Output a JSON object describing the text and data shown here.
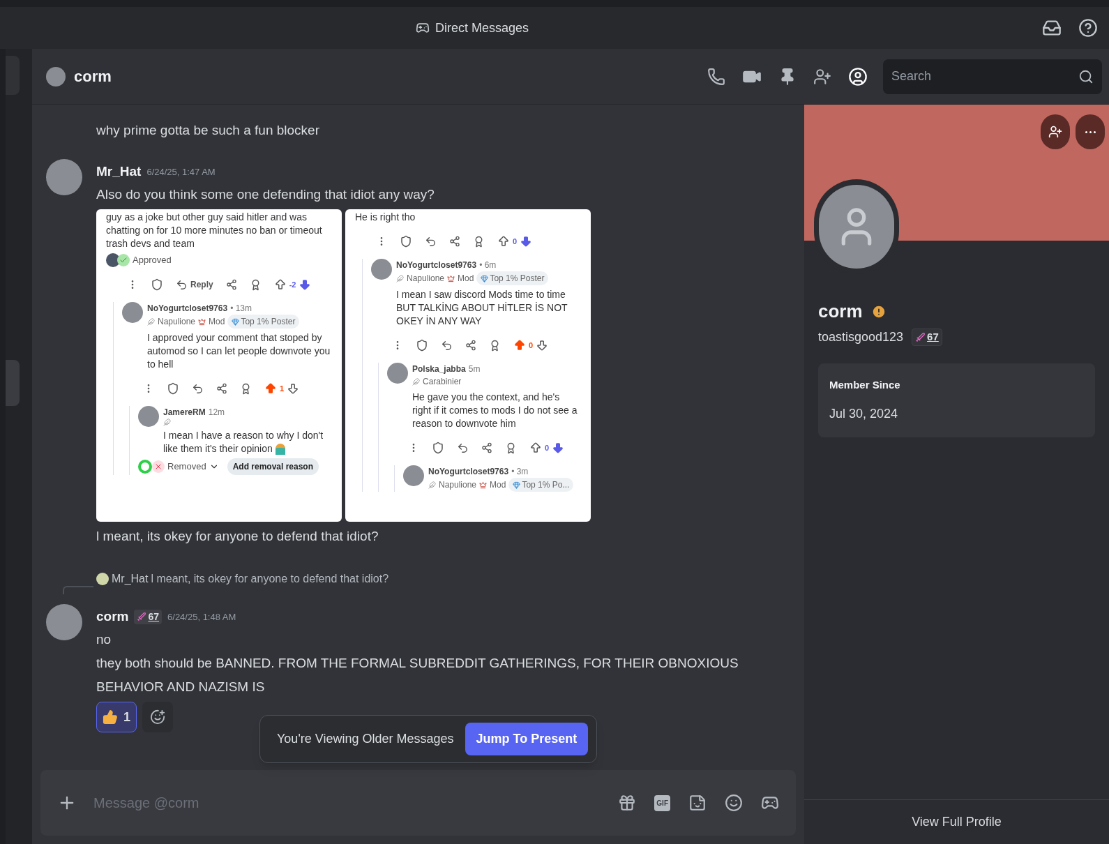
{
  "title_bar": {
    "title": "Direct Messages"
  },
  "header": {
    "name": "corm",
    "search": {
      "placeholder": "Search"
    }
  },
  "messages": [
    {
      "kind": "text",
      "text": "why prime gotta be such a fun blocker"
    },
    {
      "kind": "header",
      "author": "Mr_Hat",
      "time": "6/24/25, 1:47 AM"
    },
    {
      "kind": "text",
      "text": "Also do you think some one defending that idiot any way?"
    },
    {
      "kind": "screenshots",
      "images": [
        {
          "items": [
            {
              "kind": "text",
              "text": "guy as a joke but other guy said hitler and was chatting on for 10 more minutes no ban or timeout trash devs and team"
            },
            {
              "kind": "status",
              "approved": true,
              "label": "Approved"
            },
            {
              "kind": "actions",
              "reply": "Reply",
              "score": "-2",
              "upvoted": false,
              "downvoted": true
            },
            {
              "kind": "thread",
              "children": [
                {
                  "kind": "comment",
                  "user": "NoYogurtcloset9763",
                  "age": "• 13m",
                  "flair": "Napulione",
                  "role": "Mod",
                  "badge": "Top 1% Poster",
                  "text": "I approved your comment that stoped by automod so I can let people downvote you to hell"
                },
                {
                  "kind": "actions",
                  "score": "1",
                  "upvoted": true,
                  "downvoted": false
                },
                {
                  "kind": "thread",
                  "children": [
                    {
                      "kind": "comment",
                      "user": "JamereRM",
                      "age": "12m",
                      "text": "I mean I have a reason to why I don't like them it's their opinion",
                      "emoji": true
                    },
                    {
                      "kind": "status",
                      "approved": false,
                      "label": "Removed",
                      "button": "Add removal reason"
                    }
                  ]
                }
              ]
            }
          ]
        },
        {
          "items": [
            {
              "kind": "text",
              "text": "He is right tho"
            },
            {
              "kind": "actions",
              "score": "0",
              "upvoted": false,
              "downvoted": true
            },
            {
              "kind": "thread",
              "children": [
                {
                  "kind": "comment",
                  "user": "NoYogurtcloset9763",
                  "age": "• 6m",
                  "flair": "Napulione",
                  "role": "Mod",
                  "badge": "Top 1% Poster",
                  "text": "I mean I saw discord Mods time to time BUT TALKİNG ABOUT HİTLER İS NOT OKEY İN ANY WAY"
                },
                {
                  "kind": "actions",
                  "score": "0",
                  "upvoted": true,
                  "downvoted": false
                },
                {
                  "kind": "thread",
                  "children": [
                    {
                      "kind": "comment",
                      "user": "Polska_jabba",
                      "age": "5m",
                      "flair": "Carabinier",
                      "text": "He gave you the context, and he's right if it comes to mods I do not see a reason to downvote him"
                    },
                    {
                      "kind": "actions",
                      "score": "0",
                      "upvoted": false,
                      "downvoted": true
                    },
                    {
                      "kind": "thread",
                      "children": [
                        {
                          "kind": "comment",
                          "user": "NoYogurtcloset9763",
                          "age": "• 3m",
                          "flair": "Napulione",
                          "role": "Mod",
                          "badge": "Top 1% Po..."
                        }
                      ]
                    }
                  ]
                }
              ]
            }
          ]
        }
      ]
    },
    {
      "kind": "text",
      "text": "l meant, its okey for anyone to defend that idiot?"
    },
    {
      "kind": "reply",
      "author": "Mr_Hat",
      "text": "l meant, its okey for anyone to defend that idiot?"
    },
    {
      "kind": "header",
      "author": "corm",
      "badge": "67",
      "time": "6/24/25, 1:48 AM"
    },
    {
      "kind": "text",
      "text": "no"
    },
    {
      "kind": "text",
      "text": "they both should be BANNED. FROM THE FORMAL SUBREDDIT GATHERINGS, FOR THEIR OBNOXIOUS BEHAVIOR AND NAZISM IS"
    },
    {
      "kind": "reactions",
      "items": [
        {
          "count": "1",
          "selected": true
        }
      ]
    }
  ],
  "older_banner": {
    "text": "You're Viewing Older Messages",
    "button": "Jump To Present"
  },
  "composer": {
    "placeholder": "Message @corm",
    "gif_label": "GIF"
  },
  "profile": {
    "name": "corm",
    "username": "toastisgood123",
    "badge": "67",
    "section_title": "Member Since",
    "section_value": "Jul 30, 2024",
    "footer": "View Full Profile"
  }
}
